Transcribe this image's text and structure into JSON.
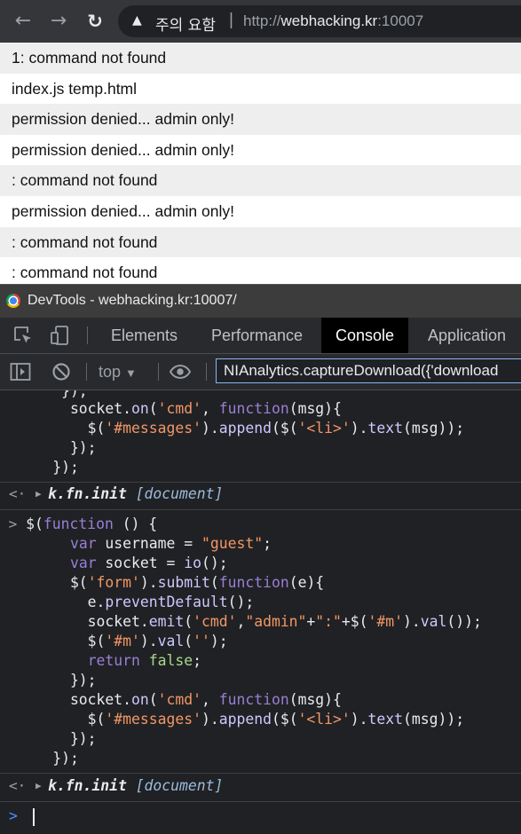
{
  "browser": {
    "security_label": "주의 요함",
    "url_scheme": "http://",
    "url_host": "webhacking.kr",
    "url_port": ":10007"
  },
  "messages": [
    "1: command not found",
    "index.js temp.html",
    "permission denied... admin only!",
    "permission denied... admin only!",
    ": command not found",
    "permission denied... admin only!",
    ": command not found",
    ": command not found"
  ],
  "devtools": {
    "title": "DevTools - webhacking.kr:10007/",
    "tabs": [
      "Elements",
      "Performance",
      "Console",
      "Application"
    ],
    "active_tab": "Console",
    "context": "top",
    "filter_value": "NIAnalytics.captureDownload({'download"
  },
  "console": {
    "result_1": "k.fn.init [document]",
    "result_2": "k.fn.init [document]"
  },
  "colors": {
    "browser_bar": "#35363a",
    "devtools_bg": "#202124",
    "accent": "#8ab4f8"
  }
}
